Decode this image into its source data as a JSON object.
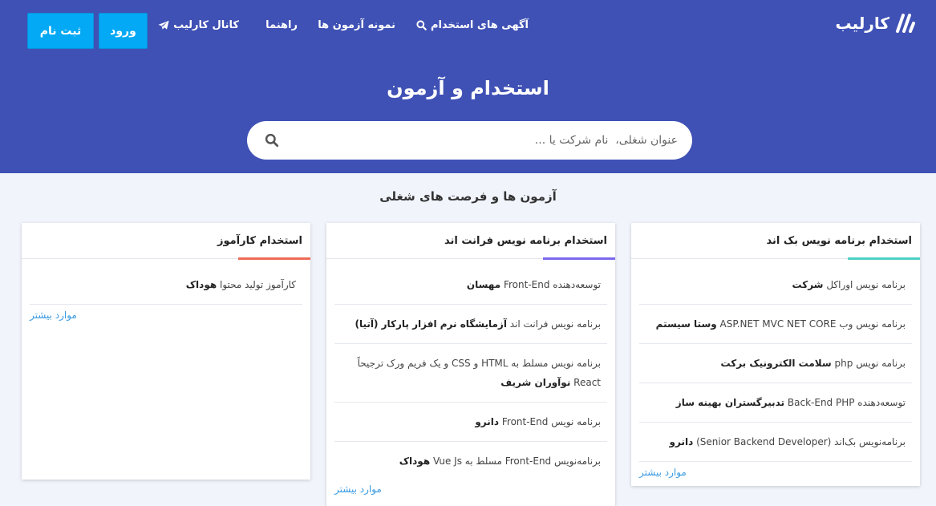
{
  "header": {
    "logo_text": "کارلیب",
    "nav": [
      {
        "label": "آگهی های استخدام",
        "icon": "search-icon"
      },
      {
        "label": "نمونه آزمون ها"
      },
      {
        "label": "راهنما"
      },
      {
        "label": "کانال کارلیب",
        "icon": "telegram-icon"
      }
    ],
    "login_label": "ورود",
    "register_label": "ثبت نام"
  },
  "hero": {
    "title": "استخدام و آزمون",
    "search_placeholder": "عنوان شغلی،  نام شرکت یا ..."
  },
  "section_title": "آزمون ها و فرصت های شغلی",
  "colors": {
    "header_bg": "#3f51b5",
    "button_bg": "#03a9f4",
    "page_bg": "#f1f4fb",
    "link": "#3b9ae1"
  },
  "cards": [
    {
      "title": "استخدام برنامه نویس بک اند",
      "accent": "#4dd0c4",
      "more_label": "موارد بیشتر",
      "jobs": [
        {
          "role": "برنامه نویس اوراکل",
          "company": "شرکت"
        },
        {
          "role": "برنامه نویس وب ASP.NET MVC NET CORE",
          "company": "وستا سیستم"
        },
        {
          "role": "برنامه نویس php",
          "company": "سلامت الکترونیک برکت"
        },
        {
          "role": "توسعه‌دهنده Back-End PHP",
          "company": "تدبیرگستران بهینه ساز"
        },
        {
          "role": "برنامه‌نویس بک‌اند (Senior Backend Developer)",
          "company": "دانرو"
        }
      ]
    },
    {
      "title": "استخدام برنامه نویس فرانت اند",
      "accent": "#7b68ee",
      "more_label": "موارد بیشتر",
      "jobs": [
        {
          "role": "توسعه‌دهنده Front-End",
          "company": "مهسان"
        },
        {
          "role": "برنامه نویس فرانت اند",
          "company": "آزمایشگاه نرم افزار پارکار (آتیا)"
        },
        {
          "role": "برنامه نویس مسلط به HTML و CSS و یک فریم ورک ترجیحاً React",
          "company": "نوآوران شریف"
        },
        {
          "role": "برنامه نویس Front-End",
          "company": "دانرو"
        },
        {
          "role": "برنامه‌نویس Front-End مسلط به Vue Js",
          "company": "هوداک"
        }
      ]
    },
    {
      "title": "استخدام کارآموز",
      "accent": "#ef6b57",
      "more_label": "موارد بیشتر",
      "jobs": [
        {
          "role": "کارآموز تولید محتوا",
          "company": "هوداک"
        }
      ]
    }
  ]
}
